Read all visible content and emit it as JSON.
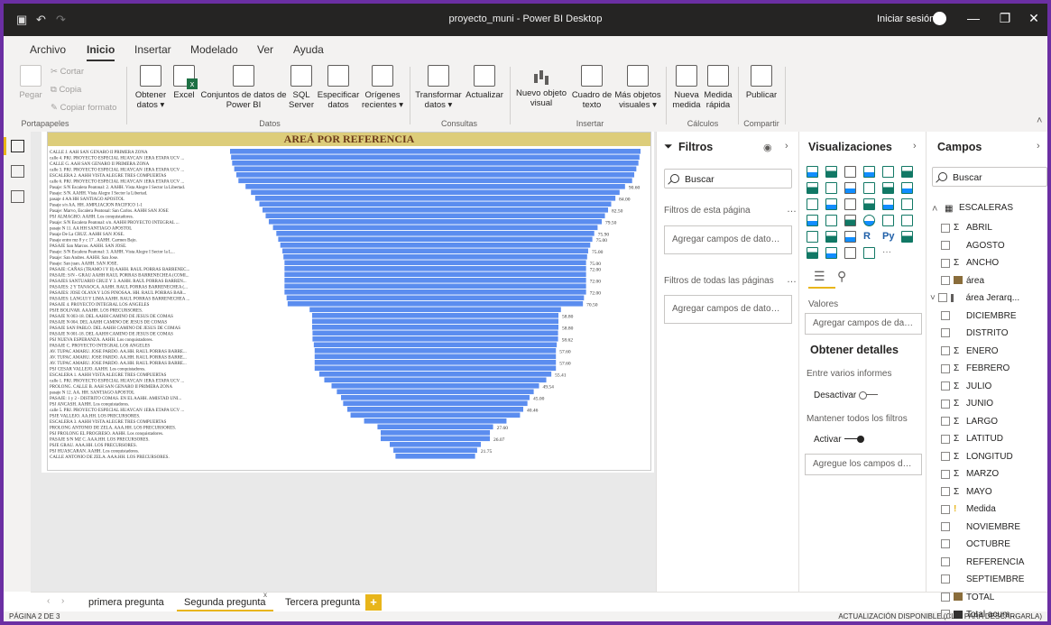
{
  "window": {
    "title": "proyecto_muni - Power BI Desktop",
    "signin": "Iniciar sesión"
  },
  "menu": [
    "Archivo",
    "Inicio",
    "Insertar",
    "Modelado",
    "Ver",
    "Ayuda"
  ],
  "ribbon": {
    "pegar": "Pegar",
    "cortar": "Cortar",
    "copia": "Copia",
    "copiar_formato": "Copiar formato",
    "obtener_datos": [
      "Obtener",
      "datos ▾"
    ],
    "excel": "Excel",
    "conjuntos": [
      "Conjuntos de datos de",
      "Power BI"
    ],
    "sql": [
      "SQL",
      "Server"
    ],
    "especificar": [
      "Especificar",
      "datos"
    ],
    "origenes": [
      "Orígenes",
      "recientes ▾"
    ],
    "transformar": [
      "Transformar",
      "datos ▾"
    ],
    "actualizar": "Actualizar",
    "nuevo_objeto": [
      "Nuevo objeto",
      "visual"
    ],
    "cuadro_texto": [
      "Cuadro de",
      "texto"
    ],
    "mas_objetos": [
      "Más objetos",
      "visuales ▾"
    ],
    "nueva_medida": [
      "Nueva",
      "medida"
    ],
    "medida_rapida": [
      "Medida",
      "rápida"
    ],
    "publicar": "Publicar",
    "groups": [
      "Portapapeles",
      "Datos",
      "Consultas",
      "Insertar",
      "Cálculos",
      "Compartir"
    ]
  },
  "chart_data": {
    "type": "bar",
    "title": "AREÁ POR REFERENCIA",
    "bar_color": "#5b8def",
    "categories": [
      "CALLE J. AAH SAN GENARO II PRIMERA ZONA",
      "calle 4. PRJ. PROYECTO ESPECIAL HUAYCAN 1ERA ETAPA UCV ...",
      "CALLE G. AAH SAN GENARO II PRIMERA ZONA",
      "calle 3. PRJ. PROYECTO ESPECIAL HUAYCAN 1ERA ETAPA UCV ...",
      "ESCALERA 2. AAHH VISTA ALEGRE TRES COMPUERTAS",
      "calle 6. PRJ. PROYECTO ESPECIAL HUAYCAN 1ERA ETAPA UCV ...",
      "Pasaje: S/N Escalera Peatonal: 2. AAHH. Vista Alegre I Sector la Libertad.",
      "Pasaje: S/N. AAHH. Vista Alegre I Sector la Libertad.",
      "pasaje 4 AA HH SANTIAGO APOSTOL",
      "Pasaje s/n AA. HH. AMPLIACION PACIFICO 1-1",
      "Pasaje: Marvo, Escalera Peatonal: San Carlos. AAHH SAN JOSE",
      "PSJ ALMAGRO. AAHH. Los conquistadores.",
      "Pasaje: S/N Escalera Peatonal: s/n. AAHH PROYECTO INTEGRAL ...",
      "pasaje N 11. AA HH SANTIAGO APOSTOL",
      "Pasaje De La CRUZ. AAHH SAN JOSE.",
      "Pasaje entre mz 8 y c 17 . AAHH. Carmen Bajo.",
      "PASAJE San Marcos. AAHH. SAN JOSE.",
      "Pasaje: S/N Escalera Peatonal: 3. AAHH. Vista Alegre I Sector la L...",
      "Pasaje: San Andres. AAHH. San Jose.",
      "Pasaje: San juan. AAHH. SAN JOSE.",
      "PASAJE: CAÑAS (TRAMO I Y II) AAHH. RAUL PORRAS BARRENEC...",
      "PASAJE: S/N - GRAU AAHH RAUL PORRAS BARRENECHEA (COMI...",
      "PASAJES SANTUARIO CRUZ Y 3. AAHH. RAUL PORRAS BARREN...",
      "PASAJES: 2 Y TANAOCA. AAHH. RAUL PORRAS BARRENECHEA (...",
      "PASAJES: JOSE OLAYA Y LOS PINOSAA. HH. RAUL PORRAS BAR...",
      "PASAJES: LANGUI Y LIMA AAHH. RAUL PORRAS BARRENECHEA ...",
      "PASAJE 4. PROYECTO INTEGRAL LOS ANGELES",
      "PSJE BOLIVAR. AAAHH. LOS PRECURSORES.",
      "PASAJE N 003-18. DEL AAHH CAMINO DE JESUS DE COMAS",
      "PASAJE N 004. DEL AAHH CAMINO DE JESUS DE COMAS",
      "PASAJE SAN PABLO. DEL AAHH CAMINO DE JESUS DE COMAS",
      "PASAJE N 001-18. DEL AAHH CAMINO DE JESUS DE COMAS",
      "PSJ NUEVA ESPERANZA. AAHH. Los conquistadores.",
      "PASAJE C. PROYECTO INTEGRAL LOS ANGELES",
      "AV. TUPAC AMARU. JOSE PARDO. AA.HH. RAUL PORRAS BARRE...",
      "AV. TUPAC AMARU. JOSE PARDO. AA.HH. RAUL PORRAS BARRE...",
      "AV. TUPAC AMARU. JOSE PARDO. AA.HH. RAUL PORRAS BARRE...",
      "PSJ CESAR VALLEJO. AAHH. Los conquistadores.",
      "ESCALERA 1. AAHH VISTA ALEGRE TRES COMPUERTAS",
      "calle 1. PRJ. PROYECTO ESPECIAL HUAYCAN 1ERA ETAPA UCV ...",
      "PROLONG. CALLE B. AAH SAN GENARO II PRIMERA ZONA",
      "pasaje N 12. AA. HH. SANTIAGO APOSTOL",
      "PASAJE: 1 y 2 - DISTRITO COMAS. EN EL AAHH. AMISTAD UNI...",
      "PSJ ANCASH. AAHH. Los conquistadores.",
      "calle 5. PRJ. PROYECTO ESPECIAL HUAYCAN 1ERA ETAPA UCV ...",
      "PSJE VALLEJO. AA.HH. LOS PRECURSORES.",
      "ESCALERA 3. AAHH VISTA ALEGRE TRES COMPUERTAS",
      "PROLONG ANTONIO DE ZELA. AAA.HH. LOS PRECURSORES.",
      "PSJ PROLONG EL PROGRESO. AAHH. Los conquistadores.",
      "PASAJE S/N MZ C. AAA.HH. LOS PRECURSORES.",
      "PSJE GRAU. AAA.HH. LOS PRECURSORES.",
      "PSJ HUASCARAN. AAHH. Los conquistadores.",
      "CALLE ANTONIO DE ZELA. AAA.HH. LOS PRECURSORES."
    ],
    "values": [
      98,
      97.5,
      97,
      96,
      95,
      94,
      90.6,
      88,
      86,
      84,
      82.5,
      81,
      79.5,
      77.5,
      75.9,
      75,
      74,
      73,
      72.5,
      72,
      72,
      72,
      72,
      72,
      72,
      71,
      70.5,
      60,
      58.8,
      58.8,
      58.8,
      58.62,
      58.62,
      58,
      57.6,
      57.6,
      57.6,
      57.6,
      55.41,
      53,
      49.54,
      47,
      45,
      44,
      42,
      40.46,
      34,
      27.6,
      26.07,
      26.07,
      21.75,
      20,
      19
    ],
    "data_labels": [
      "",
      "",
      "",
      "",
      "",
      "",
      "90.60",
      "",
      "84.00",
      "",
      "82.50",
      "",
      "79.50",
      "",
      "75.90",
      "75.00",
      "",
      "75.00",
      "",
      "75.00",
      "72.00",
      "",
      "72.00",
      "",
      "72.00",
      "",
      "70.50",
      "",
      "58.80",
      "",
      "58.80",
      "",
      "58.62",
      "",
      "57.60",
      "",
      "57.60",
      "",
      "55.41",
      "",
      "49.54",
      "",
      "45.00",
      "",
      "40.46",
      "",
      "",
      "27.60",
      "",
      "26.07",
      "",
      "21.75",
      ""
    ]
  },
  "page_tabs": [
    "primera pregunta",
    "Segunda pregunta",
    "Tercera pregunta"
  ],
  "status": {
    "left": "PÁGINA 2 DE 3",
    "right": "ACTUALIZACIÓN DISPONIBLE (CLIC PARA DESCARGARLA)"
  },
  "filters": {
    "title": "Filtros",
    "search": "Buscar",
    "page_label": "Filtros de esta página",
    "page_drop": "Agregar campos de datos ...",
    "all_label": "Filtros de todas las páginas",
    "all_drop": "Agregar campos de datos ..."
  },
  "viz": {
    "title": "Visualizaciones",
    "valores": "Valores",
    "valores_drop": "Agregar campos de datos a...",
    "detalles": "Obtener detalles",
    "entre": "Entre varios informes",
    "desactivar": "Desactivar",
    "mantener": "Mantener todos los filtros",
    "activar": "Activar",
    "agregue": "Agregue los campos de ob...",
    "r_label": "R",
    "py_label": "Py"
  },
  "campos": {
    "title": "Campos",
    "search": "Buscar",
    "table": "ESCALERAS",
    "fields": [
      {
        "name": "ABRIL",
        "sigma": true
      },
      {
        "name": "AGOSTO",
        "sigma": false
      },
      {
        "name": "ANCHO",
        "sigma": true
      },
      {
        "name": "área",
        "icon": "table"
      },
      {
        "name": "área Jerarq...",
        "icon": "hier"
      },
      {
        "name": "DICIEMBRE",
        "sigma": false
      },
      {
        "name": "DISTRITO",
        "sigma": false
      },
      {
        "name": "ENERO",
        "sigma": true
      },
      {
        "name": "FEBRERO",
        "sigma": true
      },
      {
        "name": "JULIO",
        "sigma": true
      },
      {
        "name": "JUNIO",
        "sigma": true
      },
      {
        "name": "LARGO",
        "sigma": true
      },
      {
        "name": "LATITUD",
        "sigma": true
      },
      {
        "name": "LONGITUD",
        "sigma": true
      },
      {
        "name": "MARZO",
        "sigma": true
      },
      {
        "name": "MAYO",
        "sigma": true
      },
      {
        "name": "Medida",
        "icon": "medida"
      },
      {
        "name": "NOVIEMBRE",
        "sigma": false
      },
      {
        "name": "OCTUBRE",
        "sigma": false
      },
      {
        "name": "REFERENCIA",
        "sigma": false
      },
      {
        "name": "SEPTIEMBRE",
        "sigma": false
      },
      {
        "name": "TOTAL",
        "icon": "table"
      },
      {
        "name": "Total acum...",
        "icon": "calc"
      }
    ]
  }
}
